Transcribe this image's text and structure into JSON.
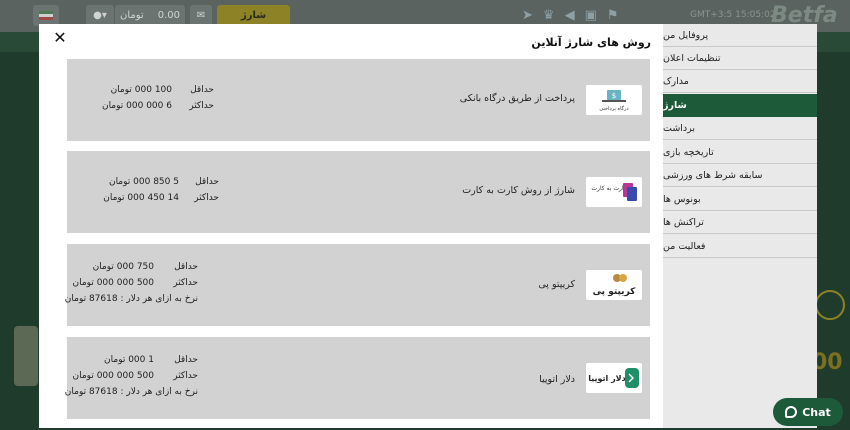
{
  "header": {
    "charge_label": "شارژ",
    "balance": "0.00",
    "currency": "تومان",
    "time": "GMT+3:5  15:05:02",
    "logo": "Betfa"
  },
  "modal": {
    "title": "روش های شارژ آنلاین",
    "methods": [
      {
        "name": "پرداخت از طریق درگاه بانکی",
        "logo_text": "درگاه پرداختی",
        "min_label": "حداقل",
        "min_value": "100 000  تومان",
        "max_label": "حداکثر",
        "max_value": "6 000 000  تومان",
        "rate": ""
      },
      {
        "name": "شارژ از روش کارت به کارت",
        "logo_text": "کارت به کارت",
        "min_label": "حداقل",
        "min_value": "5 850 000  تومان",
        "max_label": "حداکثر",
        "max_value": "14 450 000  تومان",
        "rate": ""
      },
      {
        "name": "کریپتو پی",
        "logo_text": "کریپتو پی",
        "min_label": "حداقل",
        "min_value": "750 000  تومان",
        "max_label": "حداکثر",
        "max_value": "500 000 000  تومان",
        "rate": "نرخ به ازای هر دلار : 87618 تومان"
      },
      {
        "name": "دلار اتوپیا",
        "logo_text": "دلار اتوپیا",
        "min_label": "حداقل",
        "min_value": "1 000  تومان",
        "max_label": "حداکثر",
        "max_value": "500 000 000  تومان",
        "rate": "نرخ به ازای هر دلار : 87618 تومان"
      }
    ]
  },
  "sidebar": {
    "items": [
      {
        "label": "پروفایل من"
      },
      {
        "label": "تنظیمات اعلان"
      },
      {
        "label": "مدارک"
      },
      {
        "label": "شارژ"
      },
      {
        "label": "برداشت"
      },
      {
        "label": "تاریخچه بازی"
      },
      {
        "label": "سابقه شرط های ورزشی"
      },
      {
        "label": "بونوس ها"
      },
      {
        "label": "تراکنش ها"
      },
      {
        "label": "فعالیت من"
      }
    ],
    "active_index": 3
  },
  "chat": {
    "label": "Chat"
  },
  "colors": {
    "accent": "#1c5a3a",
    "card": "#d2d2d2",
    "charge": "#8e8226"
  }
}
